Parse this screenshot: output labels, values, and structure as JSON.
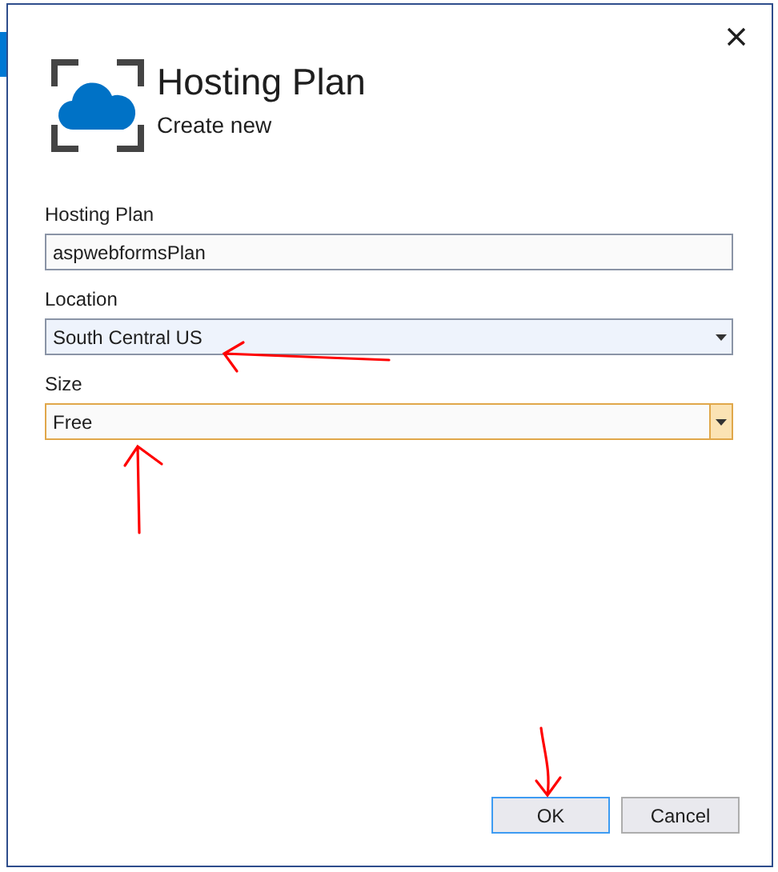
{
  "dialog": {
    "title": "Hosting Plan",
    "subtitle": "Create new"
  },
  "fields": [
    {
      "label": "Hosting Plan",
      "kind": "text",
      "value": "aspwebformsPlan",
      "highlighted": false,
      "focused": false
    },
    {
      "label": "Location",
      "kind": "dropdown",
      "value": "South Central US",
      "highlighted": true,
      "focused": false
    },
    {
      "label": "Size",
      "kind": "dropdown",
      "value": "Free",
      "highlighted": false,
      "focused": true
    }
  ],
  "buttons": [
    {
      "label": "OK",
      "default": true
    },
    {
      "label": "Cancel",
      "default": false
    }
  ]
}
